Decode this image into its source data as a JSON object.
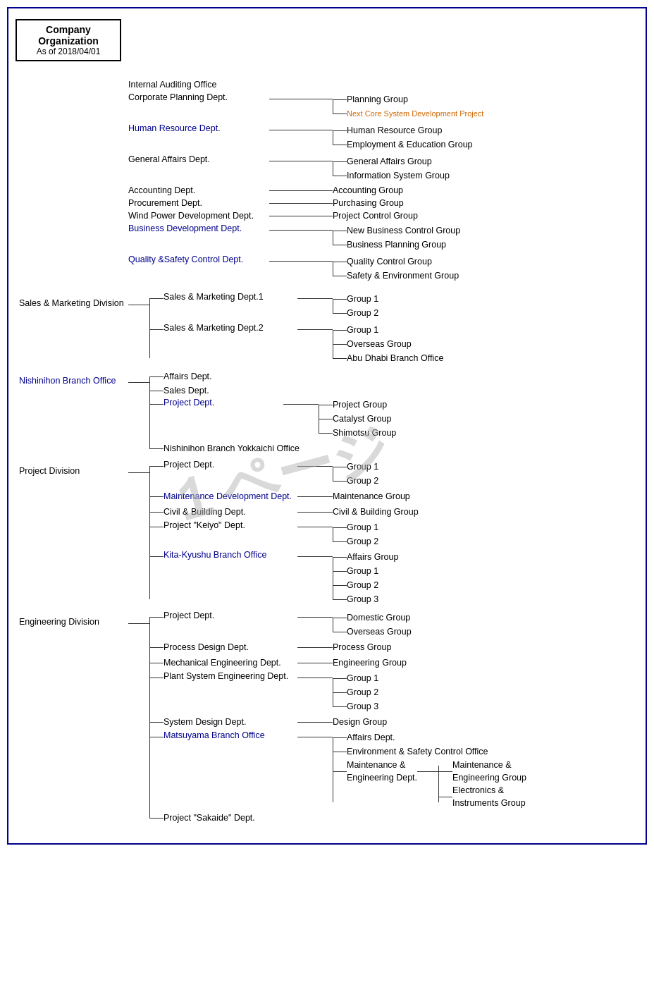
{
  "header": {
    "title": "Company Organization",
    "date": "As of 2018/04/01"
  },
  "chart": {
    "top_offices": [
      {
        "label": "Internal Auditing Office",
        "color": "black"
      },
      {
        "label": "Corporate Planning Dept.",
        "color": "black",
        "children": [
          {
            "label": "Planning Group",
            "color": "black"
          },
          {
            "label": "Next Core System Development Project",
            "color": "orange"
          }
        ]
      },
      {
        "label": "Human Resource Dept.",
        "color": "blue",
        "children": [
          {
            "label": "Human Resource Group",
            "color": "black"
          },
          {
            "label": "Employment & Education Group",
            "color": "black"
          }
        ]
      },
      {
        "label": "General Affairs Dept.",
        "color": "black",
        "children": [
          {
            "label": "General Affairs Group",
            "color": "black"
          },
          {
            "label": "Information System Group",
            "color": "black"
          }
        ]
      },
      {
        "label": "Accounting Dept.",
        "color": "black",
        "single_child": "Accounting Group"
      },
      {
        "label": "Procurement Dept.",
        "color": "black",
        "single_child": "Purchasing Group"
      },
      {
        "label": "Wind Power Development Dept.",
        "color": "black",
        "single_child": "Project Control Group"
      },
      {
        "label": "Business Development Dept.",
        "color": "blue",
        "children": [
          {
            "label": "New Business Control Group",
            "color": "black"
          },
          {
            "label": "Business Planning Group",
            "color": "black"
          }
        ]
      },
      {
        "label": "Quality &Safety Control Dept.",
        "color": "blue",
        "children": [
          {
            "label": "Quality Control Group",
            "color": "black"
          },
          {
            "label": "Safety & Environment Group",
            "color": "black"
          }
        ]
      }
    ],
    "divisions": [
      {
        "label": "Sales & Marketing Division",
        "color": "black",
        "departments": [
          {
            "label": "Sales & Marketing Dept.1",
            "color": "black",
            "children": [
              {
                "label": "Group 1"
              },
              {
                "label": "Group 2"
              }
            ]
          },
          {
            "label": "Sales & Marketing Dept.2",
            "color": "black",
            "children": [
              {
                "label": "Group 1"
              },
              {
                "label": "Overseas Group"
              },
              {
                "label": "Abu Dhabi Branch Office"
              }
            ]
          }
        ]
      },
      {
        "label": "Nishinihon Branch Office",
        "color": "blue",
        "departments": [
          {
            "label": "Affairs Dept.",
            "color": "black"
          },
          {
            "label": "Sales Dept.",
            "color": "black"
          },
          {
            "label": "Project Dept.",
            "color": "blue",
            "children": [
              {
                "label": "Project Group"
              },
              {
                "label": "Catalyst Group"
              },
              {
                "label": "Shimotsu Group"
              }
            ]
          },
          {
            "label": "Nishinihon Branch Yokkaichi Office",
            "color": "black"
          }
        ]
      },
      {
        "label": "Project Division",
        "color": "black",
        "departments": [
          {
            "label": "Project Dept.",
            "color": "black",
            "children": [
              {
                "label": "Group 1"
              },
              {
                "label": "Group 2"
              }
            ]
          },
          {
            "label": "Maintenance Development Dept.",
            "color": "blue",
            "single_child": "Maintenance Group"
          },
          {
            "label": "Civil & Building Dept.",
            "color": "black",
            "single_child": "Civil & Building Group"
          },
          {
            "label": "Project \"Keiyo\" Dept.",
            "color": "black",
            "children": [
              {
                "label": "Group 1"
              },
              {
                "label": "Group 2"
              }
            ]
          },
          {
            "label": "Kita-Kyushu Branch Office",
            "color": "blue",
            "children": [
              {
                "label": "Affairs Group"
              },
              {
                "label": "Group 1"
              },
              {
                "label": "Group 2"
              },
              {
                "label": "Group 3"
              }
            ]
          }
        ]
      },
      {
        "label": "Engineering Division",
        "color": "black",
        "departments": [
          {
            "label": "Project Dept.",
            "color": "black",
            "children": [
              {
                "label": "Domestic Group"
              },
              {
                "label": "Overseas Group"
              }
            ]
          },
          {
            "label": "Process Design Dept.",
            "color": "black",
            "single_child": "Process Group"
          },
          {
            "label": "Mechanical Engineering Dept.",
            "color": "black",
            "single_child": "Engineering Group"
          },
          {
            "label": "Plant System Engineering Dept.",
            "color": "black",
            "children": [
              {
                "label": "Group 1"
              },
              {
                "label": "Group 2"
              },
              {
                "label": "Group 3"
              }
            ]
          },
          {
            "label": "System Design Dept.",
            "color": "black",
            "single_child": "Design Group"
          },
          {
            "label": "Matsuyama Branch Office",
            "color": "blue",
            "children": [
              {
                "label": "Affairs Dept."
              },
              {
                "label": "Environment & Safety Control Office"
              },
              {
                "label": "Maintenance & Engineering Dept.",
                "sub_children": [
                  {
                    "label": "Maintenance & Engineering Group"
                  },
                  {
                    "label": "Electronics & Instruments Group"
                  }
                ]
              }
            ]
          },
          {
            "label": "Project \"Sakaide\" Dept.",
            "color": "black"
          }
        ]
      }
    ]
  }
}
